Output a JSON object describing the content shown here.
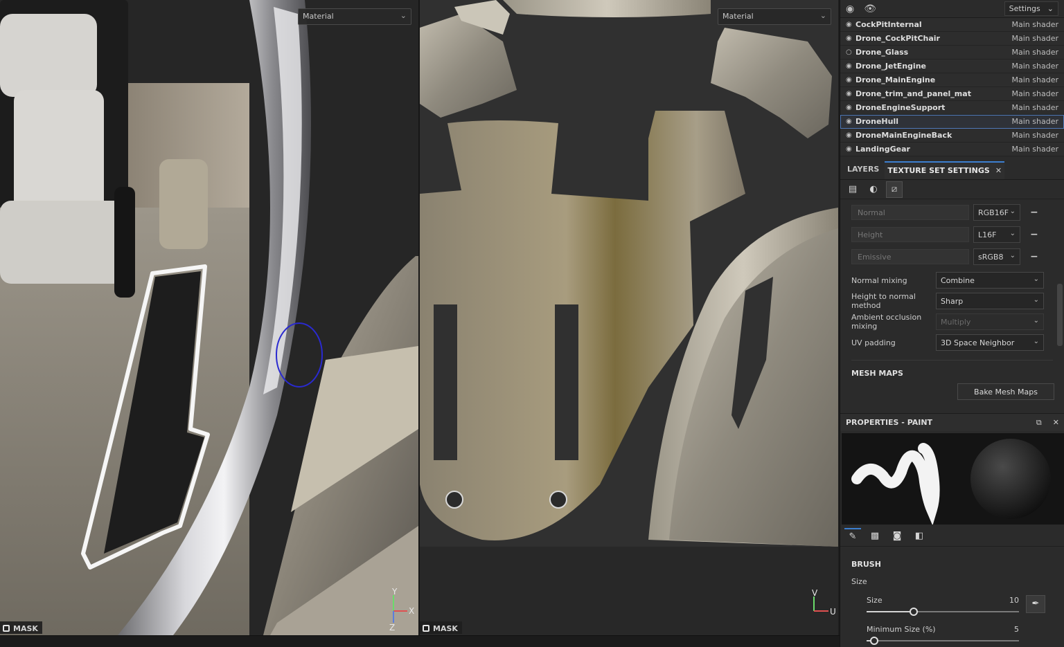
{
  "viewport_3d": {
    "material_dropdown": "Material",
    "mask_label": "MASK",
    "axis": {
      "y": "Y",
      "x": "X",
      "z": "Z"
    }
  },
  "viewport_2d": {
    "material_dropdown": "Material",
    "mask_label": "MASK",
    "axis": {
      "v": "V",
      "u": "U"
    }
  },
  "texture_set_list": {
    "settings_label": "Settings",
    "rows": [
      {
        "name": "CockPitInternal",
        "shader": "Main shader",
        "visible": true
      },
      {
        "name": "Drone_CockPitChair",
        "shader": "Main shader",
        "visible": true
      },
      {
        "name": "Drone_Glass",
        "shader": "Main shader",
        "visible": false
      },
      {
        "name": "Drone_JetEngine",
        "shader": "Main shader",
        "visible": true
      },
      {
        "name": "Drone_MainEngine",
        "shader": "Main shader",
        "visible": true
      },
      {
        "name": "Drone_trim_and_panel_mat",
        "shader": "Main shader",
        "visible": true
      },
      {
        "name": "DroneEngineSupport",
        "shader": "Main shader",
        "visible": true
      },
      {
        "name": "DroneHull",
        "shader": "Main shader",
        "visible": true,
        "selected": true
      },
      {
        "name": "DroneMainEngineBack",
        "shader": "Main shader",
        "visible": true
      },
      {
        "name": "LandingGear",
        "shader": "Main shader",
        "visible": true
      }
    ]
  },
  "tabs": {
    "layers": "LAYERS",
    "texture_set_settings": "TEXTURE SET SETTINGS",
    "close": "✕"
  },
  "texture_set_settings": {
    "channels": [
      {
        "name": "Normal",
        "format": "RGB16F"
      },
      {
        "name": "Height",
        "format": "L16F"
      },
      {
        "name": "Emissive",
        "format": "sRGB8"
      }
    ],
    "options": [
      {
        "label": "Normal mixing",
        "value": "Combine",
        "enabled": true
      },
      {
        "label": "Height to normal method",
        "value": "Sharp",
        "enabled": true
      },
      {
        "label": "Ambient occlusion mixing",
        "value": "Multiply",
        "enabled": false
      },
      {
        "label": "UV padding",
        "value": "3D Space Neighbor",
        "enabled": true
      }
    ],
    "mesh_maps_header": "MESH MAPS",
    "bake_button": "Bake Mesh Maps"
  },
  "properties": {
    "header": "PROPERTIES - PAINT",
    "brush_header": "BRUSH",
    "size_group": "Size",
    "size": {
      "label": "Size",
      "value": "10",
      "fraction": 0.31
    },
    "min_size": {
      "label": "Minimum Size (%)",
      "value": "5",
      "fraction": 0.05
    }
  },
  "colors": {
    "accent": "#3c7fd0",
    "selection_outline": "#4f79b8",
    "annotation": "#2a2ad0"
  }
}
